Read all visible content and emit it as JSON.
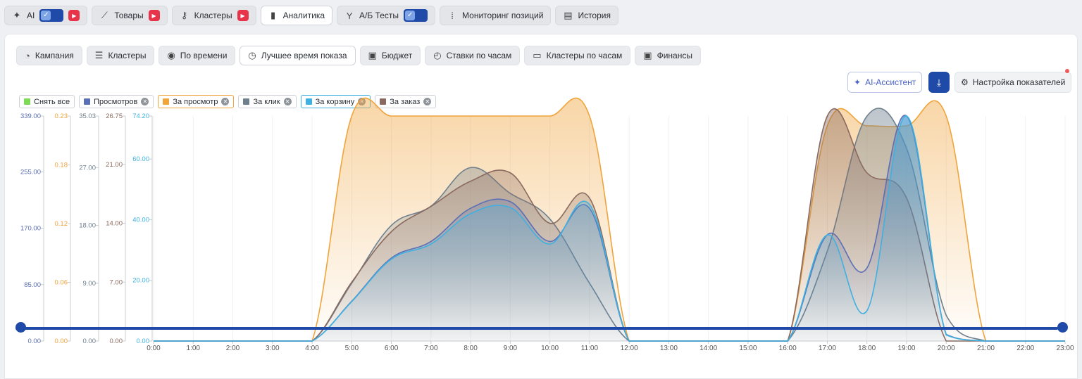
{
  "top_tabs": [
    {
      "label": "AI",
      "icon": "sparkle-icon",
      "toggle": true,
      "active": false
    },
    {
      "label": "Товары",
      "icon": "chart-line-icon",
      "badge": true,
      "active": false
    },
    {
      "label": "Кластеры",
      "icon": "key-icon",
      "badge": true,
      "active": false
    },
    {
      "label": "Аналитика",
      "icon": "bar-chart-icon",
      "active": true
    },
    {
      "label": "А/Б Тесты",
      "icon": "split-icon",
      "toggle": true,
      "active": false
    },
    {
      "label": "Мониторинг позиций",
      "icon": "grid-dots-icon",
      "active": false
    },
    {
      "label": "История",
      "icon": "history-icon",
      "active": false
    }
  ],
  "sub_tabs": [
    {
      "label": "Кампания",
      "icon": "megaphone-icon",
      "active": false
    },
    {
      "label": "Кластеры",
      "icon": "list-check-icon",
      "active": false
    },
    {
      "label": "По времени",
      "icon": "stopwatch-icon",
      "active": false
    },
    {
      "label": "Лучшее время показа",
      "icon": "timer-icon",
      "active": true
    },
    {
      "label": "Бюджет",
      "icon": "wallet-icon",
      "active": false
    },
    {
      "label": "Ставки по часам",
      "icon": "clock-rewind-icon",
      "active": false
    },
    {
      "label": "Кластеры по часам",
      "icon": "dollar-card-icon",
      "active": false
    },
    {
      "label": "Финансы",
      "icon": "wallet-icon",
      "active": false
    }
  ],
  "actions": {
    "ai_assistant": "AI-Ассистент",
    "download_icon": "download-icon",
    "settings": "Настройка показателей"
  },
  "legend": [
    {
      "label": "Снять все",
      "color": "#7ed957",
      "removable": false
    },
    {
      "label": "Просмотров",
      "color": "#5b6fb5",
      "removable": true
    },
    {
      "label": "За просмотр",
      "color": "#f0a43c",
      "removable": true
    },
    {
      "label": "За клик",
      "color": "#6e7f8d",
      "removable": true
    },
    {
      "label": "За корзину",
      "color": "#3fb1e0",
      "removable": true
    },
    {
      "label": "За заказ",
      "color": "#8a6a5f",
      "removable": true
    }
  ],
  "chart_data": {
    "type": "area",
    "x": [
      "0:00",
      "1:00",
      "2:00",
      "3:00",
      "4:00",
      "5:00",
      "6:00",
      "7:00",
      "8:00",
      "9:00",
      "10:00",
      "11:00",
      "12:00",
      "13:00",
      "14:00",
      "15:00",
      "16:00",
      "17:00",
      "18:00",
      "19:00",
      "20:00",
      "21:00",
      "22:00",
      "23:00"
    ],
    "y_axes": [
      {
        "series": "Просмотров",
        "color": "#5b6fb5",
        "ticks": [
          "339.00",
          "255.00",
          "170.00",
          "85.00",
          "0.00"
        ],
        "max": 339
      },
      {
        "series": "За просмотр",
        "color": "#f0a43c",
        "ticks": [
          "0.23",
          "0.18",
          "0.12",
          "0.06",
          "0.00"
        ],
        "max": 0.23
      },
      {
        "series": "За клик",
        "color": "#6e7f8d",
        "ticks": [
          "35.03",
          "27.00",
          "18.00",
          "9.00",
          "0.00"
        ],
        "max": 35.03
      },
      {
        "series": "За заказ",
        "color": "#8a6a5f",
        "ticks": [
          "26.75",
          "21.00",
          "14.00",
          "7.00",
          "0.00"
        ],
        "max": 26.75
      },
      {
        "series": "За корзину",
        "color": "#3fb1e0",
        "ticks": [
          "74.20",
          "60.00",
          "40.00",
          "20.00",
          "0.00"
        ],
        "max": 74.2
      }
    ],
    "series": [
      {
        "name": "За просмотр",
        "color": "#f0a43c",
        "axis": 1,
        "values": [
          0,
          0,
          0,
          0,
          0,
          0.23,
          0.23,
          0.23,
          0.23,
          0.23,
          0.23,
          0.23,
          0,
          0,
          0,
          0,
          0,
          0.22,
          0.22,
          0.22,
          0.23,
          0,
          0,
          0
        ]
      },
      {
        "name": "За клик",
        "color": "#6e7f8d",
        "axis": 2,
        "values": [
          0,
          0,
          0,
          0,
          0,
          9,
          18,
          21,
          27,
          23,
          19,
          9,
          0,
          0,
          0,
          0,
          0,
          14,
          35,
          30,
          4,
          0,
          0,
          0
        ]
      },
      {
        "name": "За заказ",
        "color": "#8a6a5f",
        "axis": 3,
        "values": [
          0,
          0,
          0,
          0,
          0,
          7,
          13,
          16,
          19,
          20,
          14,
          17,
          0,
          0,
          0,
          0,
          0,
          26.75,
          20,
          17,
          0,
          0,
          0,
          0
        ]
      },
      {
        "name": "Просмотров",
        "color": "#5b6fb5",
        "axis": 0,
        "values": [
          0,
          0,
          0,
          0,
          0,
          60,
          125,
          150,
          200,
          210,
          150,
          200,
          0,
          0,
          0,
          0,
          0,
          160,
          110,
          339,
          10,
          0,
          0,
          0
        ]
      },
      {
        "name": "За корзину",
        "color": "#3fb1e0",
        "axis": 4,
        "values": [
          0,
          0,
          0,
          0,
          0,
          13,
          27,
          32,
          42,
          44,
          32,
          45,
          0,
          0,
          0,
          0,
          0,
          35,
          10,
          74.2,
          2,
          0,
          0,
          0
        ]
      }
    ],
    "grid": true
  }
}
